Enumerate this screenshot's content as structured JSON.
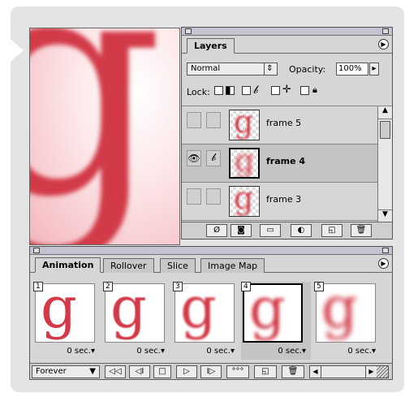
{
  "layers_panel": {
    "tab_label": "Layers",
    "blend_mode": "Normal",
    "opacity_label": "Opacity:",
    "opacity_value": "100%",
    "lock_label": "Lock:",
    "layers": [
      {
        "name": "frame 5",
        "visible": false,
        "selected": false
      },
      {
        "name": "frame 4",
        "visible": true,
        "selected": true
      },
      {
        "name": "frame 3",
        "visible": false,
        "selected": false
      }
    ]
  },
  "animation_panel": {
    "tabs": [
      "Animation",
      "Rollover",
      "Slice",
      "Image Map"
    ],
    "active_tab": "Animation",
    "frames": [
      {
        "number": "1",
        "duration": "0 sec.",
        "blur": 0
      },
      {
        "number": "2",
        "duration": "0 sec.",
        "blur": 0.5
      },
      {
        "number": "3",
        "duration": "0 sec.",
        "blur": 1.2
      },
      {
        "number": "4",
        "duration": "0 sec.",
        "blur": 2.2,
        "selected": true
      },
      {
        "number": "5",
        "duration": "0 sec.",
        "blur": 3.2
      }
    ],
    "loop_option": "Forever",
    "duration_suffix": "▾"
  },
  "canvas": {
    "glyph": "g"
  },
  "colors": {
    "glyph_red": "#d23a48",
    "panel_bg": "#d6d6d6",
    "selected_row": "#c4c4c4"
  }
}
